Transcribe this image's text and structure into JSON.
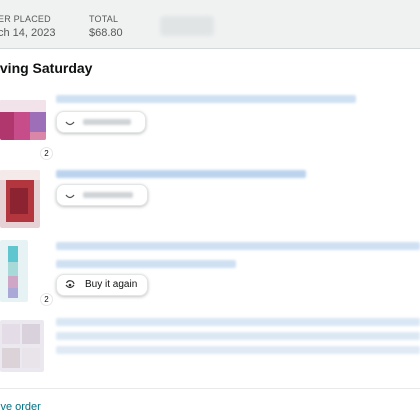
{
  "header": {
    "order_placed_label": "ER PLACED",
    "order_placed_value": "ch 14, 2023",
    "total_label": "TOTAL",
    "total_value": "$68.80"
  },
  "shipment": {
    "status": "iving Saturday"
  },
  "items": [
    {
      "quantity": "2",
      "action_label": ""
    },
    {
      "quantity": "",
      "action_label": ""
    },
    {
      "quantity": "2",
      "action_label": "Buy it again"
    },
    {
      "quantity": "",
      "action_label": ""
    }
  ],
  "footer": {
    "archive_link": "ive order"
  },
  "colors": {
    "header_bg": "#f0f2f2",
    "link": "#007185",
    "muted_text": "#565959"
  }
}
